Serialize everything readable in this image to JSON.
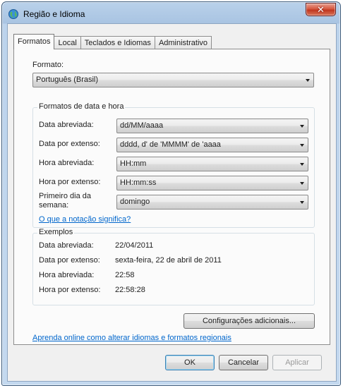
{
  "window": {
    "title": "Região e Idioma",
    "close_symbol": "✕"
  },
  "tabs": [
    "Formatos",
    "Local",
    "Teclados e Idiomas",
    "Administrativo"
  ],
  "format": {
    "label": "Formato:",
    "value": "Português (Brasil)"
  },
  "datetime": {
    "title": "Formatos de data e hora",
    "rows": [
      {
        "label": "Data abreviada:",
        "value": "dd/MM/aaaa"
      },
      {
        "label": "Data por extenso:",
        "value": "dddd, d' de 'MMMM' de 'aaaa"
      },
      {
        "label": "Hora abreviada:",
        "value": "HH:mm"
      },
      {
        "label": "Hora por extenso:",
        "value": "HH:mm:ss"
      }
    ],
    "first_day_label_1": "Primeiro dia da",
    "first_day_label_2": "semana:",
    "first_day_value": "domingo",
    "notation_link": "O que a notação significa?"
  },
  "examples": {
    "title": "Exemplos",
    "rows": [
      {
        "label": "Data abreviada:",
        "value": "22/04/2011"
      },
      {
        "label": "Data por extenso:",
        "value": "sexta-feira, 22 de abril de 2011"
      },
      {
        "label": "Hora abreviada:",
        "value": "22:58"
      },
      {
        "label": "Hora por extenso:",
        "value": "22:58:28"
      }
    ]
  },
  "buttons": {
    "additional": "Configurações adicionais...",
    "ok": "OK",
    "cancel": "Cancelar",
    "apply": "Aplicar"
  },
  "learn_link": "Aprenda online como alterar idiomas e formatos regionais",
  "icons": {
    "app": "globe-icon",
    "dropdown": "chevron-down-icon"
  }
}
